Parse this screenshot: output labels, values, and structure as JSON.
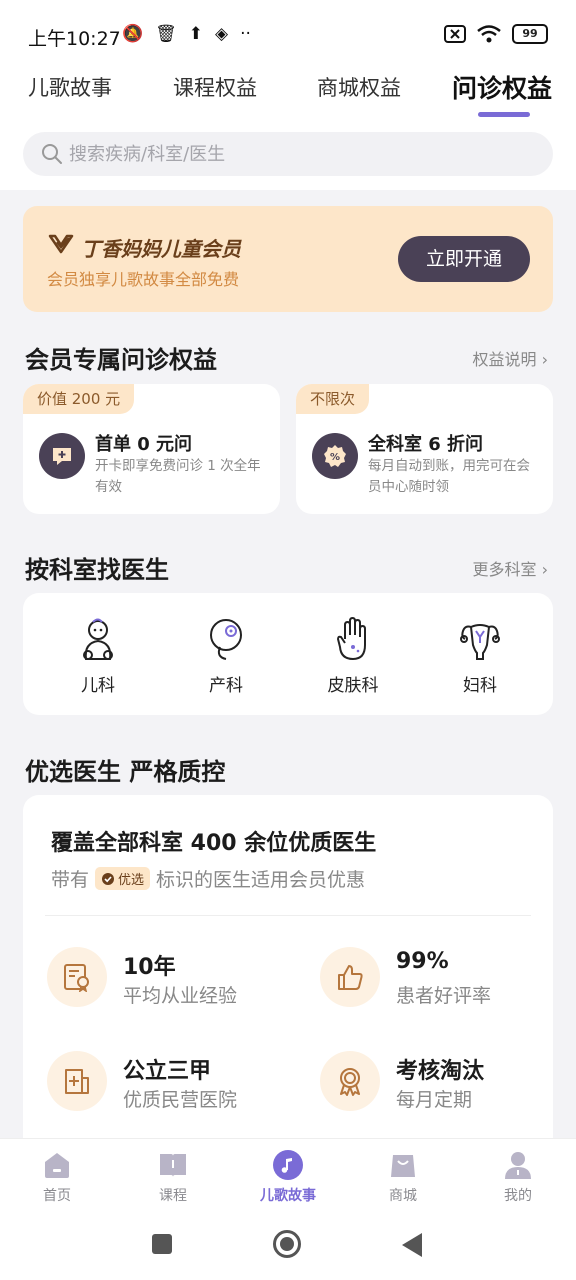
{
  "status_bar": {
    "time": "上午10:27",
    "battery": "99"
  },
  "top_tabs": [
    {
      "label": "儿歌故事",
      "active": false
    },
    {
      "label": "课程权益",
      "active": false
    },
    {
      "label": "商城权益",
      "active": false
    },
    {
      "label": "问诊权益",
      "active": true
    }
  ],
  "search": {
    "placeholder": "搜索疾病/科室/医生"
  },
  "banner": {
    "title": "丁香妈妈儿童会员",
    "subtitle": "会员独享儿歌故事全部免费",
    "button": "立即开通"
  },
  "member_benefits": {
    "title": "会员专属问诊权益",
    "link": "权益说明",
    "cards": [
      {
        "tag": "价值 200 元",
        "title": "首单 0 元问",
        "desc": "开卡即享免费问诊 1 次全年有效",
        "icon": "chat-plus-icon"
      },
      {
        "tag": "不限次",
        "title": "全科室 6 折问",
        "desc": "每月自动到账，用完可在会员中心随时领",
        "icon": "discount-badge-icon"
      }
    ]
  },
  "departments": {
    "title": "按科室找医生",
    "link": "更多科室",
    "items": [
      {
        "label": "儿科",
        "icon": "baby-icon"
      },
      {
        "label": "产科",
        "icon": "pregnancy-icon"
      },
      {
        "label": "皮肤科",
        "icon": "hand-icon"
      },
      {
        "label": "妇科",
        "icon": "uterus-icon"
      }
    ]
  },
  "doctors": {
    "title": "优选医生 严格质控",
    "headline": "覆盖全部科室 400 余位优质医生",
    "sub_prefix": "带有",
    "badge": "优选",
    "sub_suffix": "标识的医生适用会员优惠",
    "stats": [
      {
        "value": "10年",
        "label": "平均从业经验",
        "icon": "certificate-icon"
      },
      {
        "value": "99%",
        "label": "患者好评率",
        "icon": "thumbs-up-icon"
      },
      {
        "value": "公立三甲",
        "label": "优质民营医院",
        "icon": "hospital-icon"
      },
      {
        "value": "考核淘汰",
        "label": "每月定期",
        "icon": "medal-icon"
      }
    ]
  },
  "bottom_nav": [
    {
      "label": "首页",
      "icon": "home-icon",
      "active": false
    },
    {
      "label": "课程",
      "icon": "book-icon",
      "active": false
    },
    {
      "label": "儿歌故事",
      "icon": "music-icon",
      "active": true
    },
    {
      "label": "商城",
      "icon": "shopping-bag-icon",
      "active": false
    },
    {
      "label": "我的",
      "icon": "user-icon",
      "active": false
    }
  ],
  "colors": {
    "accent": "#7a6bd6",
    "dark": "#4a4156",
    "banner_bg": "#fde6c9",
    "icon_bg": "#fdf1e2"
  }
}
